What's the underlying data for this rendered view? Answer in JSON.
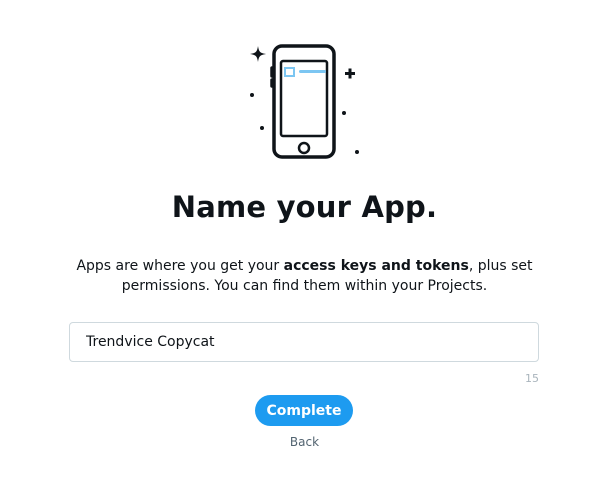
{
  "header": {
    "title": "Name your App."
  },
  "description": {
    "prefix": "Apps are where you get your ",
    "emphasis": "access keys and tokens",
    "suffix_line1": ", plus set",
    "line2": "permissions. You can find them within your Projects."
  },
  "app_name_input": {
    "value": "Trendvice Copycat",
    "remaining_chars": "15"
  },
  "actions": {
    "complete_label": "Complete",
    "back_label": "Back"
  },
  "colors": {
    "accent": "#1d9bf0",
    "illustration_accent": "#7cc6f2",
    "text": "#0f1419",
    "muted": "#536471"
  },
  "icons": {
    "illustration": "phone-illustration-icon"
  }
}
